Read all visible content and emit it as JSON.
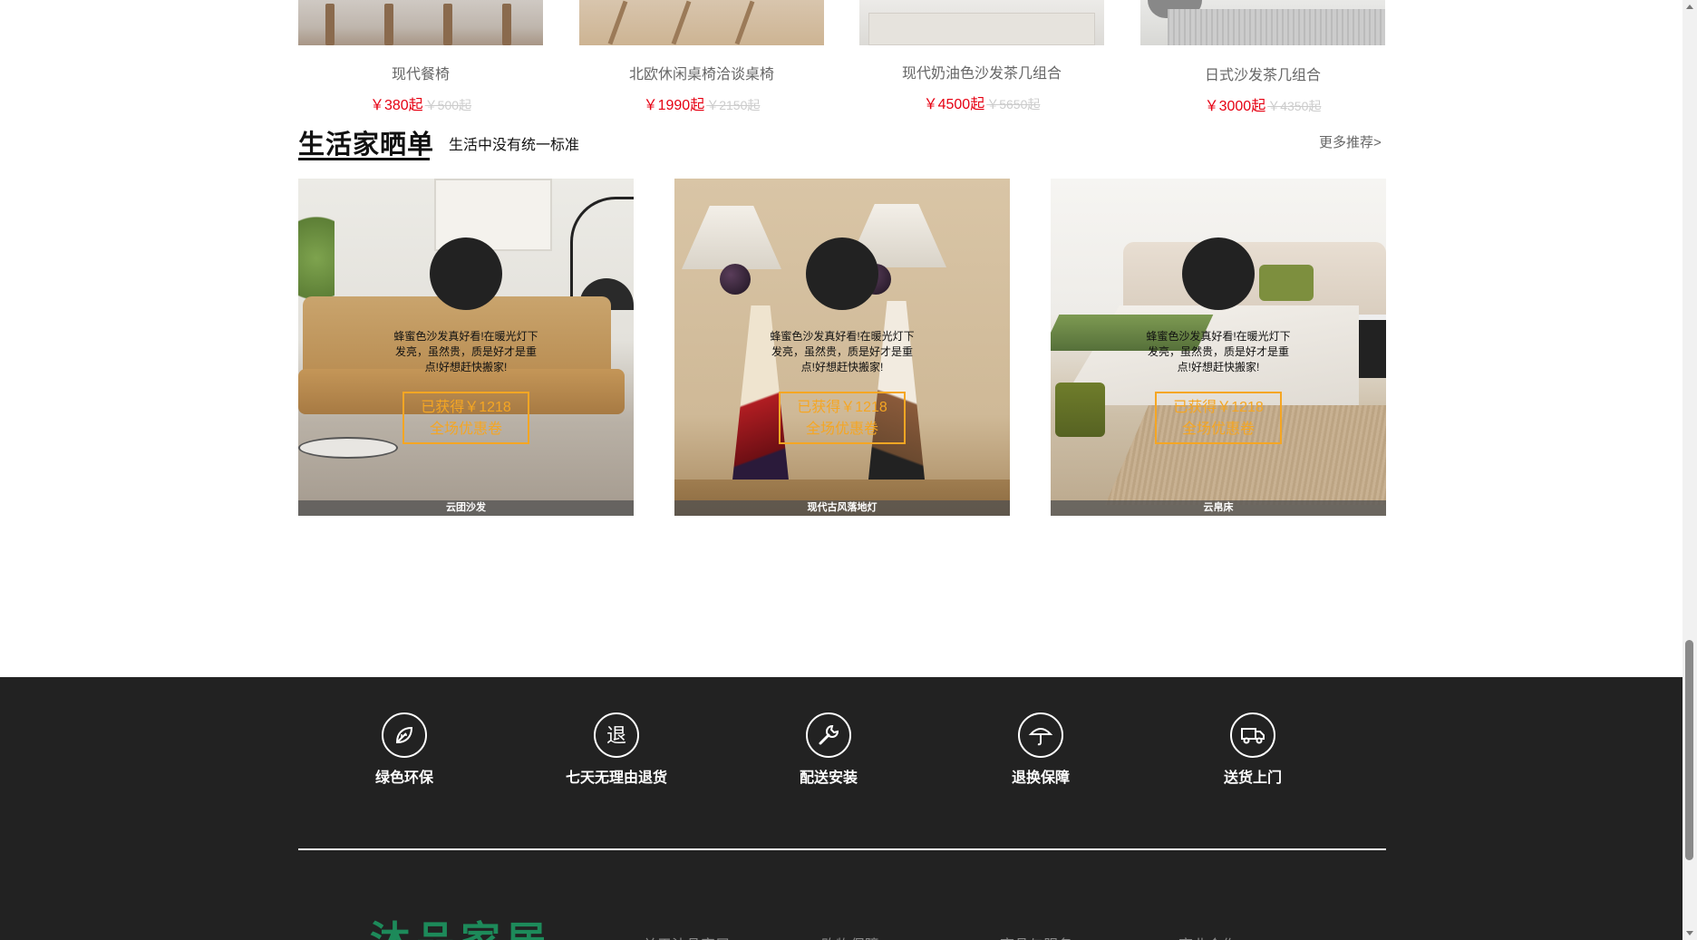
{
  "products": [
    {
      "name": "现代餐椅",
      "price": "￥380起",
      "old_price": "￥500起"
    },
    {
      "name": "北欧休闲桌椅洽谈桌椅",
      "price": "￥1990起",
      "old_price": "￥2150起"
    },
    {
      "name": "现代奶油色沙发茶几组合",
      "price": "￥4500起",
      "old_price": "￥5650起"
    },
    {
      "name": "日式沙发茶几组合",
      "price": "￥3000起",
      "old_price": "￥4350起"
    }
  ],
  "section": {
    "title": "生活家晒单",
    "subtitle": "生活中没有统一标准",
    "more": "更多推荐>"
  },
  "cards": [
    {
      "review": "蜂蜜色沙发真好看!在暖光灯下发亮，虽然贵，质是好才是重点!好想赶快搬家!",
      "coupon_line1": "已获得￥1218",
      "coupon_line2": "全场优惠卷",
      "caption": "云团沙发"
    },
    {
      "review": "蜂蜜色沙发真好看!在暖光灯下发亮，虽然贵，质是好才是重点!好想赶快搬家!",
      "coupon_line1": "已获得￥1218",
      "coupon_line2": "全场优惠卷",
      "caption": "现代古风落地灯"
    },
    {
      "review": "蜂蜜色沙发真好看!在暖光灯下发亮，虽然贵，质是好才是重点!好想赶快搬家!",
      "coupon_line1": "已获得￥1218",
      "coupon_line2": "全场优惠卷",
      "caption": "云帛床"
    }
  ],
  "footer": {
    "features": [
      {
        "label": "绿色环保",
        "icon": "leaf-icon"
      },
      {
        "label": "七天无理由退货",
        "icon": "return-icon"
      },
      {
        "label": "配送安装",
        "icon": "wrench-icon"
      },
      {
        "label": "退换保障",
        "icon": "umbrella-icon"
      },
      {
        "label": "送货上门",
        "icon": "truck-icon"
      }
    ],
    "logo": "沐品家居",
    "columns": [
      "关于沐品家居",
      "购物保障",
      "商品与服务",
      "商业合作"
    ]
  },
  "colors": {
    "price_red": "#e60012",
    "coupon_orange": "#f5a623",
    "footer_bg": "#222222",
    "logo_green": "#1d8a5a"
  }
}
